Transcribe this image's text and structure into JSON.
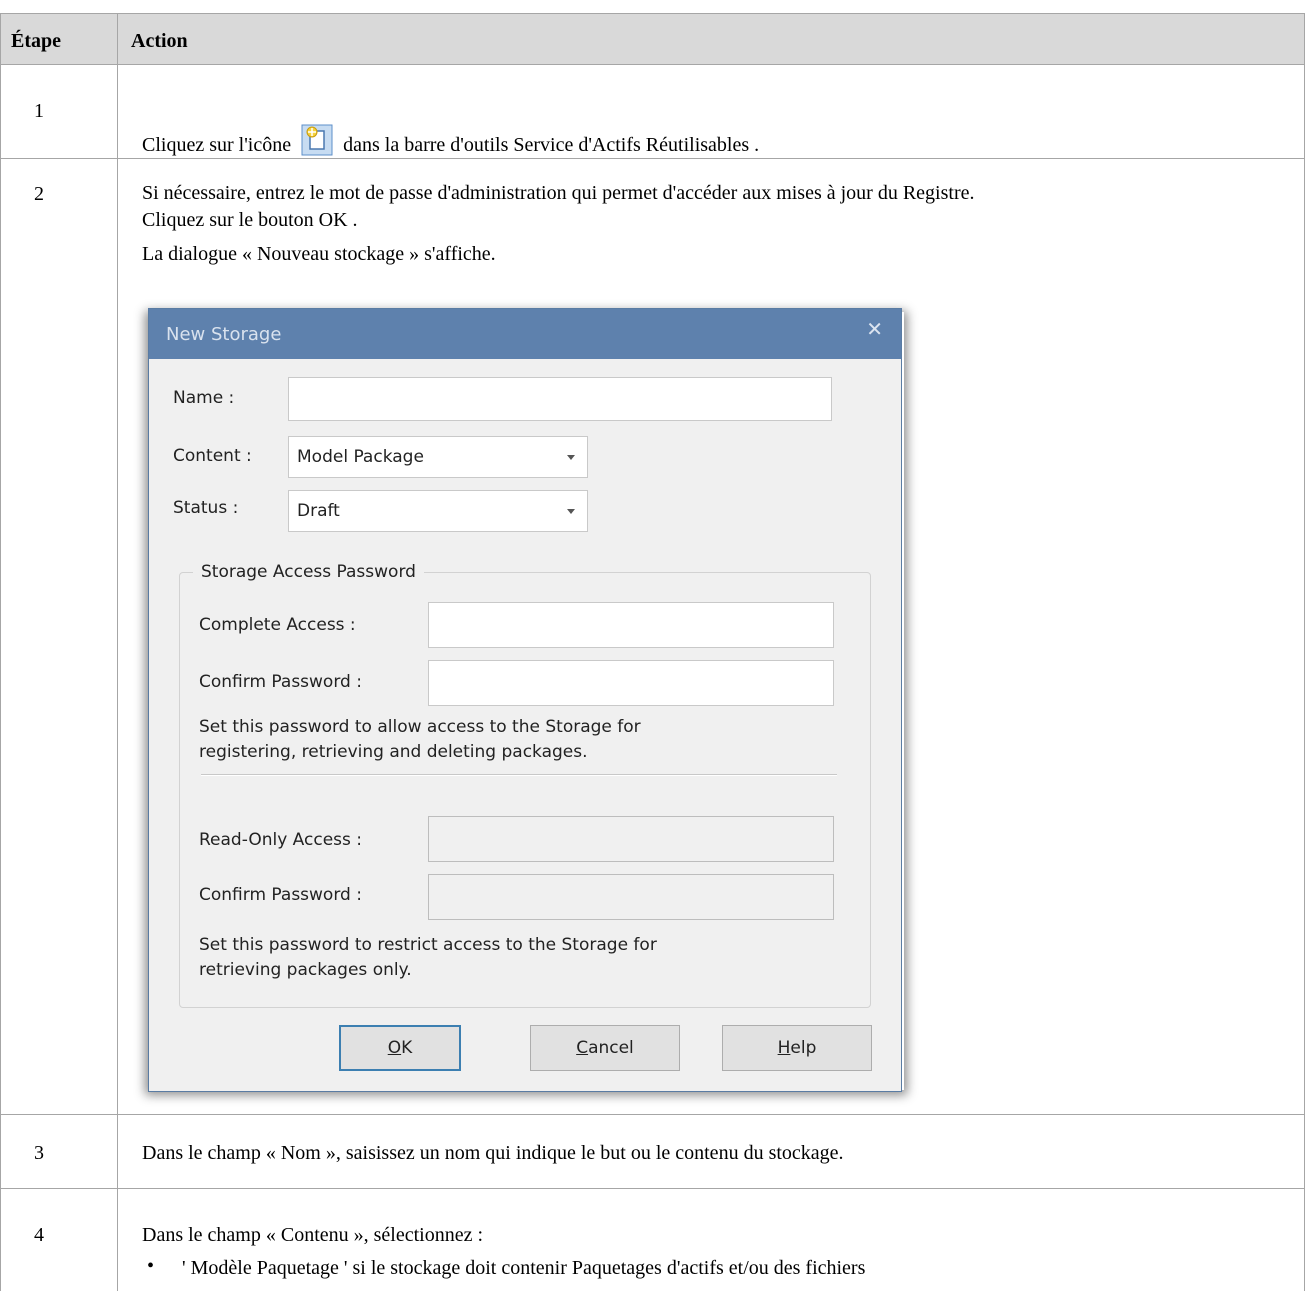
{
  "table": {
    "col_step": "Étape",
    "col_action": "Action",
    "rows": [
      {
        "step": "1",
        "action_before": "Cliquez sur l'icône",
        "action_icon": "new-storage-icon",
        "action_after": "dans la barre d'outils Service d'Actifs Réutilisables ."
      },
      {
        "step": "2",
        "lines": [
          "Si nécessaire, entrez le mot de passe d'administration qui permet d'accéder aux mises à jour du Registre.",
          "Cliquez sur le bouton OK .",
          "La dialogue « Nouveau stockage » s'affiche."
        ]
      },
      {
        "step": "3",
        "action": "Dans le champ « Nom », saisissez un nom qui indique le but ou le contenu du stockage."
      },
      {
        "step": "4",
        "action": "Dans le champ « Contenu », sélectionnez :",
        "bullets": [
          "' Modèle Paquetage ' si le stockage doit contenir Paquetages d'actifs et/ou des fichiers"
        ]
      }
    ]
  },
  "dialog": {
    "title": "New Storage",
    "close_glyph": "✕",
    "name_label": "Name :",
    "name_value": "",
    "content_label": "Content :",
    "content_value": "Model Package",
    "status_label": "Status :",
    "status_value": "Draft",
    "group_title": "Storage Access Password",
    "complete_access_label": "Complete Access :",
    "complete_access_value": "",
    "confirm_password_label_1": "Confirm Password :",
    "confirm_password_value_1": "",
    "help_text_1": [
      "Set this password to allow access to the Storage for",
      "registering, retrieving and deleting packages."
    ],
    "readonly_access_label": "Read-Only Access :",
    "readonly_access_value": "",
    "confirm_password_label_2": "Confirm Password :",
    "confirm_password_value_2": "",
    "help_text_2": [
      "Set this password to restrict access to the Storage for",
      "retrieving packages only."
    ],
    "buttons": {
      "ok_mnemonic": "O",
      "ok_rest": "K",
      "cancel_mnemonic": "C",
      "cancel_rest": "ancel",
      "help_mnemonic": "H",
      "help_rest": "elp"
    }
  },
  "colors": {
    "header_bg": "#d9d9d9",
    "grid": "#a6a6a6",
    "dialog_title_bar": "#5e81ad",
    "dialog_bg": "#f0f0f0",
    "default_button_border": "#3c7fb1"
  }
}
